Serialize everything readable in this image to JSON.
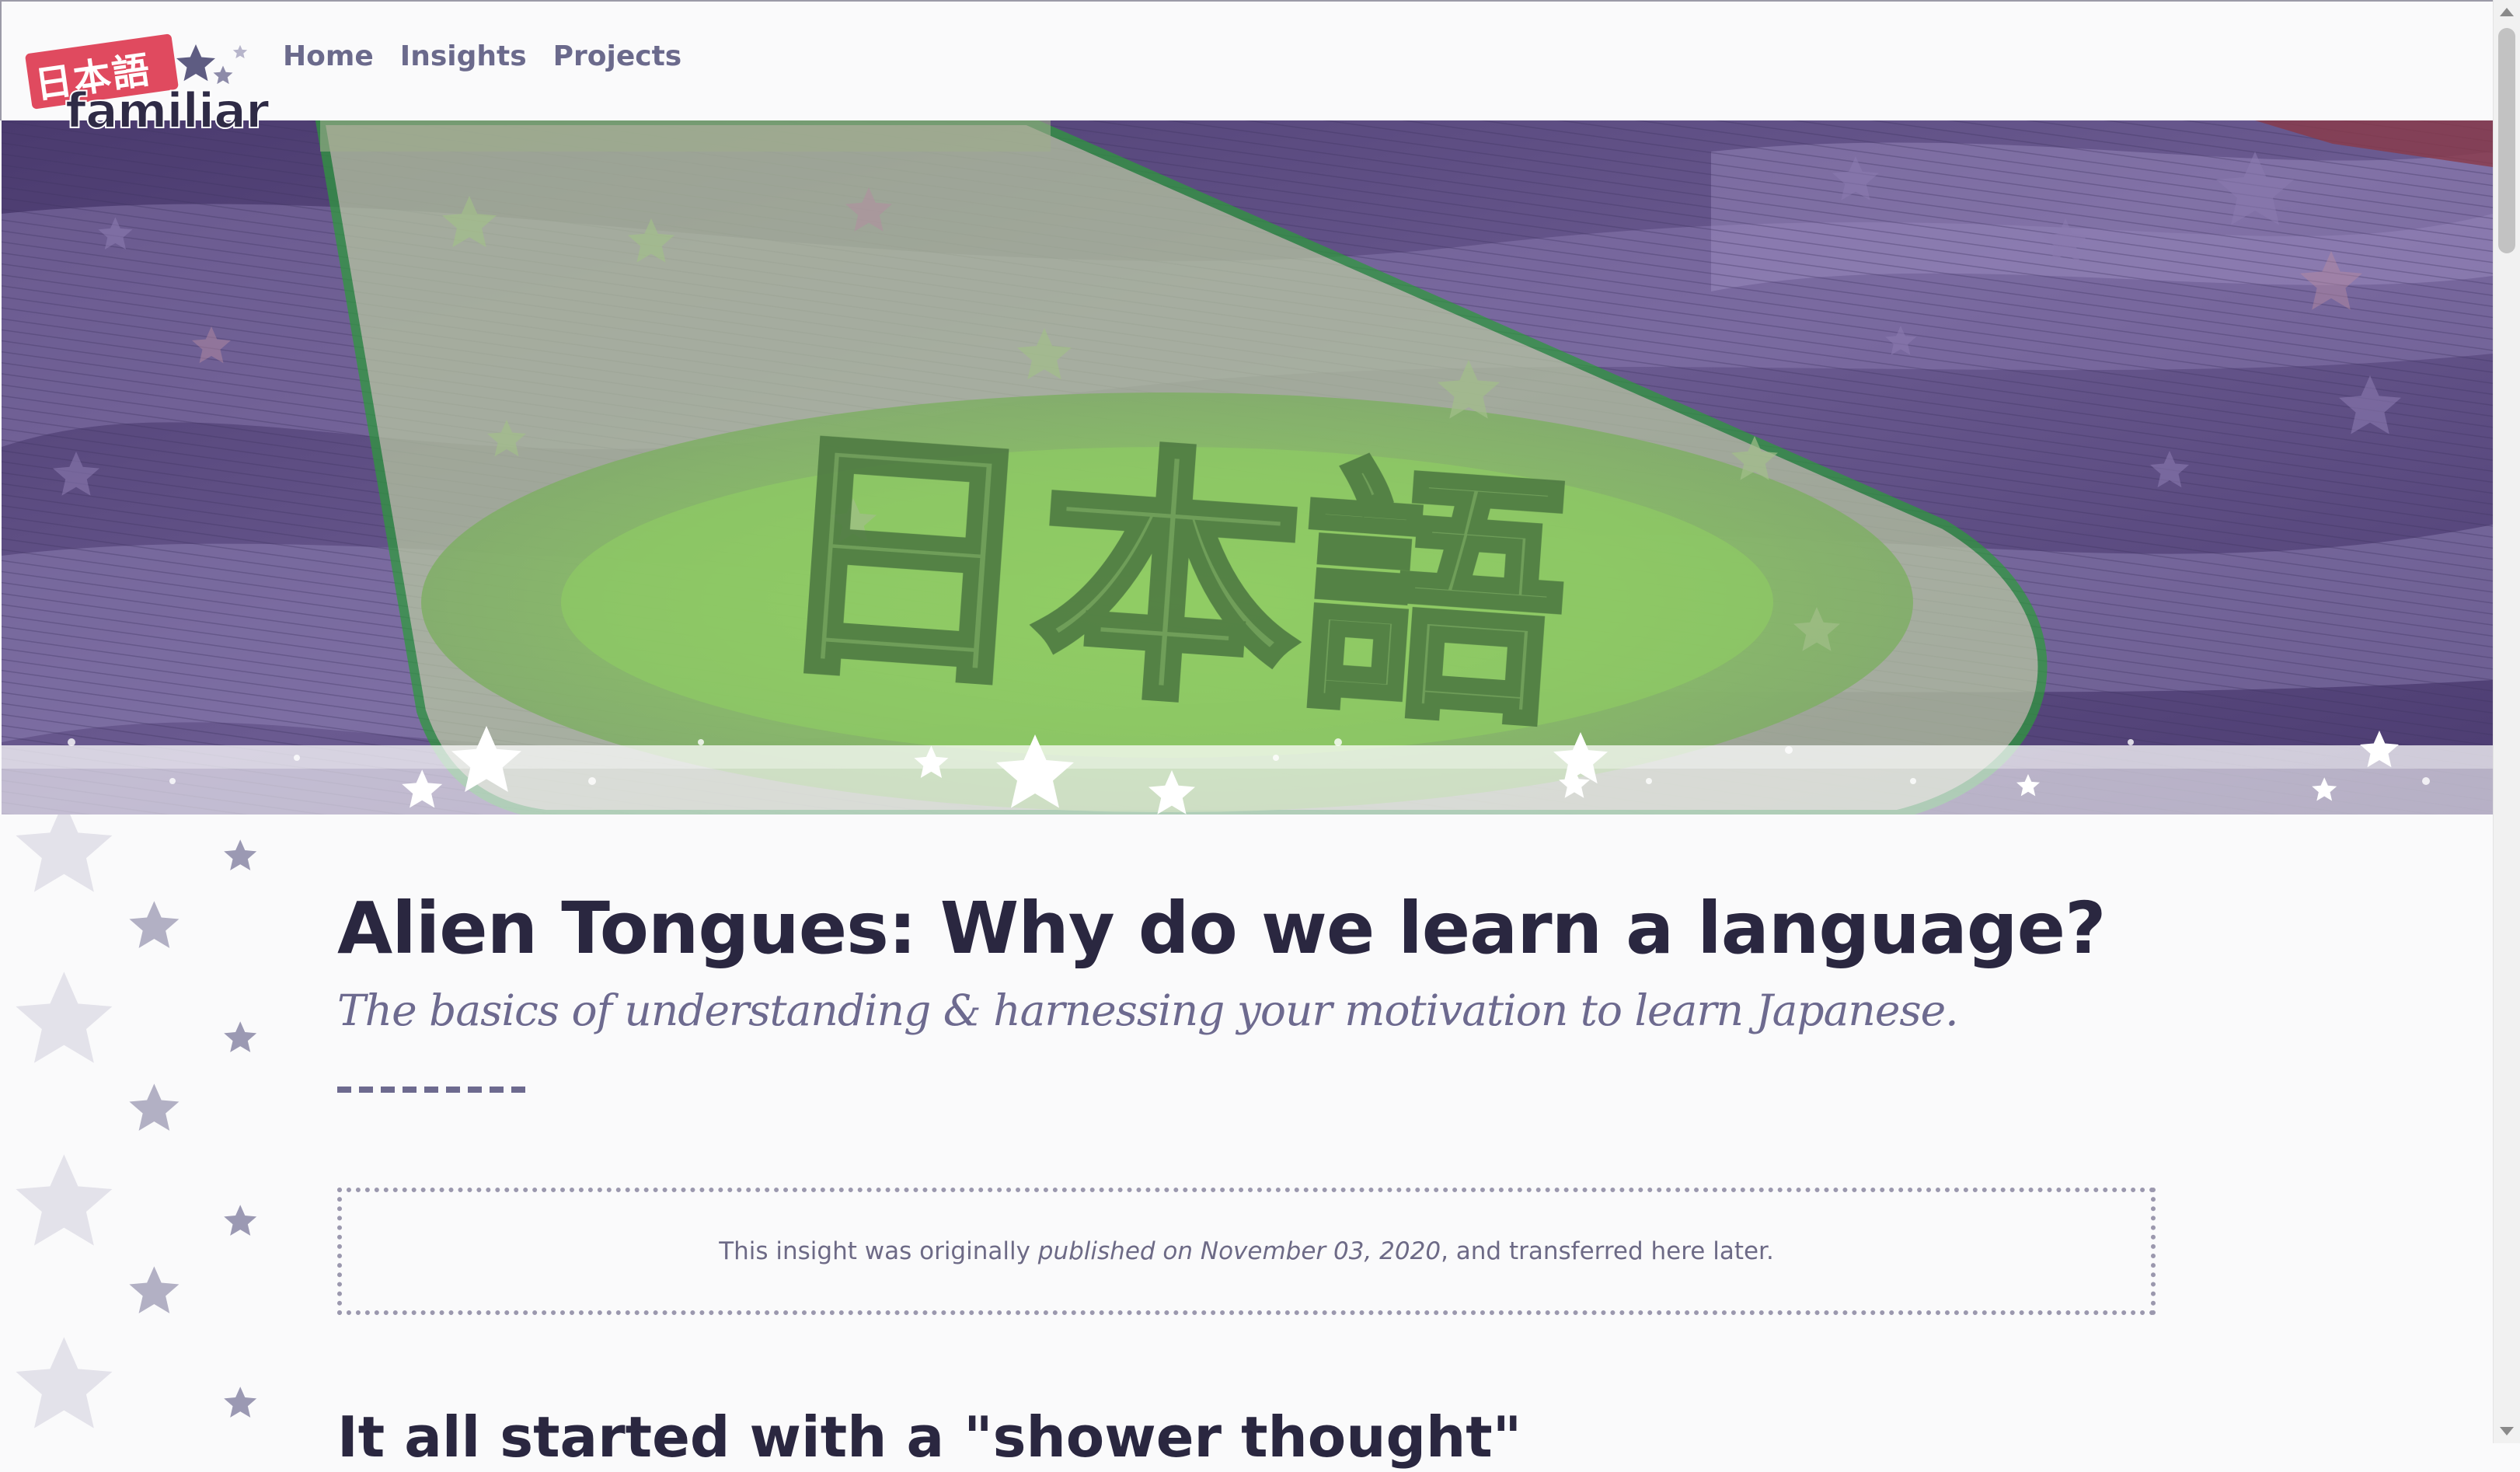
{
  "header": {
    "logo": {
      "japanese": "日本語",
      "word": "familiar"
    },
    "nav": [
      {
        "label": "Home"
      },
      {
        "label": "Insights"
      },
      {
        "label": "Projects"
      }
    ]
  },
  "hero": {
    "kanji": "日本語",
    "colors": {
      "background": "#5a4a7e",
      "spotlight": "#8cc264",
      "outline": "#2e9a3c"
    }
  },
  "article": {
    "title": "Alien Tongues: Why do we learn a language?",
    "subtitle": "The basics of understanding & harnessing your motivation to learn Japanese.",
    "notice": {
      "before": "This insight was originally ",
      "emphasis": "published on November 03, 2020",
      "after": ", and transferred here later."
    },
    "section_heading": "It all started with a \"shower thought\""
  },
  "colors": {
    "accent_red": "#e04a5f",
    "nav_text": "#6b6a8c",
    "title_text": "#2a2740",
    "subtitle_text": "#6d6a8f"
  }
}
